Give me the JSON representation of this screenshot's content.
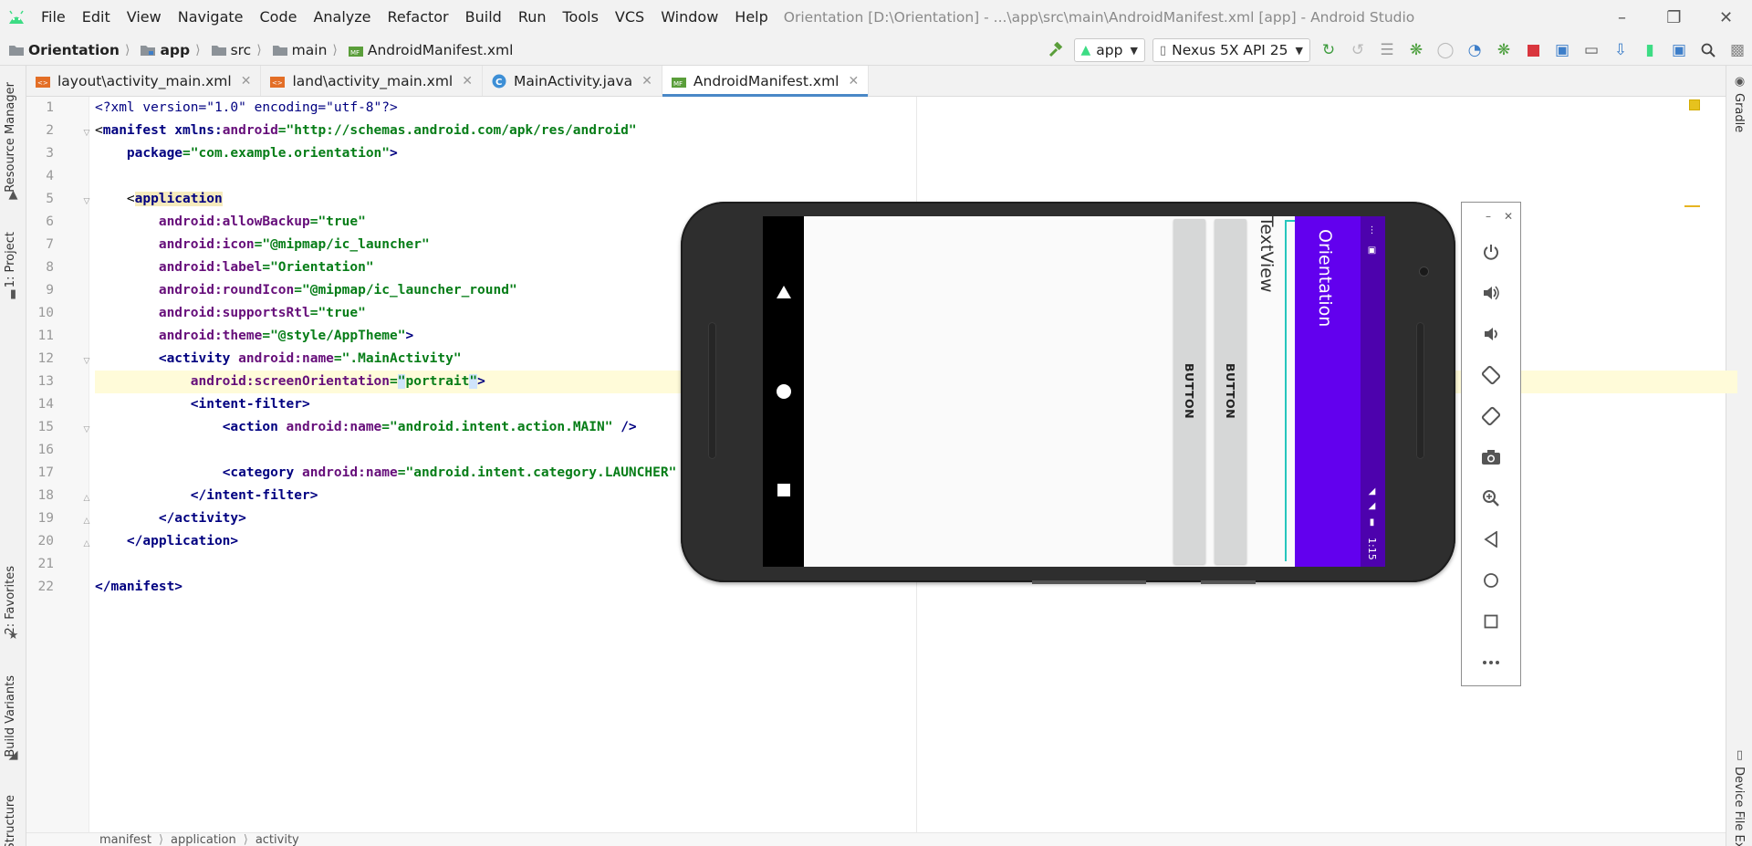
{
  "menubar": {
    "items": [
      "File",
      "Edit",
      "View",
      "Navigate",
      "Code",
      "Analyze",
      "Refactor",
      "Build",
      "Run",
      "Tools",
      "VCS",
      "Window",
      "Help"
    ],
    "window_title": "Orientation [D:\\Orientation] - ...\\app\\src\\main\\AndroidManifest.xml [app] - Android Studio"
  },
  "navbar": {
    "crumbs": [
      "Orientation",
      "app",
      "src",
      "main",
      "AndroidManifest.xml"
    ],
    "run_config": "app",
    "device": "Nexus 5X API 25"
  },
  "tabs": [
    {
      "label": "layout\\activity_main.xml",
      "icon": "xml-layout-icon"
    },
    {
      "label": "land\\activity_main.xml",
      "icon": "xml-layout-icon"
    },
    {
      "label": "MainActivity.java",
      "icon": "java-class-icon"
    },
    {
      "label": "AndroidManifest.xml",
      "icon": "manifest-icon",
      "active": true
    }
  ],
  "left_tool_windows": [
    "Resource Manager",
    "1: Project",
    "2: Favorites",
    "Build Variants",
    "Structure"
  ],
  "right_tool_windows": [
    "Gradle",
    "Device File Exp"
  ],
  "editor": {
    "line_numbers": [
      "1",
      "2",
      "3",
      "4",
      "5",
      "6",
      "7",
      "8",
      "9",
      "10",
      "11",
      "12",
      "13",
      "14",
      "15",
      "16",
      "17",
      "18",
      "19",
      "20",
      "21",
      "22"
    ],
    "current_line": "13"
  },
  "code": {
    "l1_proc": "<?xml version=\"1.0\" encoding=\"utf-8\"?>",
    "l2_open": "<",
    "l2_tag": "manifest",
    "l2_ns": " xmlns:",
    "l2_attr": "android",
    "l2_eq": "=",
    "l2_val": "\"http://schemas.android.com/apk/res/android\"",
    "l3_attr": "package",
    "l3_val": "\"com.example.orientation\"",
    "l3_close": ">",
    "l5_open": "<",
    "l5_tag": "application",
    "l6_attr": "android:allowBackup",
    "l6_val": "\"true\"",
    "l7_attr": "android:icon",
    "l7_val": "\"@mipmap/ic_launcher\"",
    "l8_attr": "android:label",
    "l8_val": "\"Orientation\"",
    "l9_attr": "android:roundIcon",
    "l9_val": "\"@mipmap/ic_launcher_round\"",
    "l10_attr": "android:supportsRtl",
    "l10_val": "\"true\"",
    "l11_attr": "android:theme",
    "l11_val": "\"@style/AppTheme\"",
    "l11_close": ">",
    "l12_tag": "<activity",
    "l12_attr": " android:name",
    "l12_val": "\".MainActivity\"",
    "l13_attr": "android:screenOrientation",
    "l13_q1": "\"",
    "l13_val": "portrait",
    "l13_q2": "\"",
    "l13_close": ">",
    "l14_tag": "<intent-filter>",
    "l15_tag": "<action",
    "l15_attr": " android:name",
    "l15_val": "\"android.intent.action.MAIN\"",
    "l15_close": " />",
    "l17_tag": "<category",
    "l17_attr": " android:name",
    "l17_val": "\"android.intent.category.LAUNCHER\"",
    "l18_tag": "</intent-filter>",
    "l19_tag": "</activity>",
    "l20_tag": "</application>",
    "l22_tag": "</manifest>"
  },
  "editor_breadcrumbs": [
    "manifest",
    "application",
    "activity"
  ],
  "emulator": {
    "app_title": "Orientation",
    "textview_text": "TextView",
    "button1_label": "BUTTON",
    "button2_label": "BUTTON",
    "status_time": "1:15",
    "colors": {
      "app_bar": "#6200ee",
      "status_bar": "#4d02ad",
      "accent": "#26c6bd"
    }
  },
  "emulator_toolbar": [
    "power-icon",
    "volume-up-icon",
    "volume-down-icon",
    "rotate-left-icon",
    "rotate-right-icon",
    "camera-icon",
    "zoom-icon",
    "back-icon",
    "home-icon",
    "overview-icon",
    "more-icon"
  ]
}
